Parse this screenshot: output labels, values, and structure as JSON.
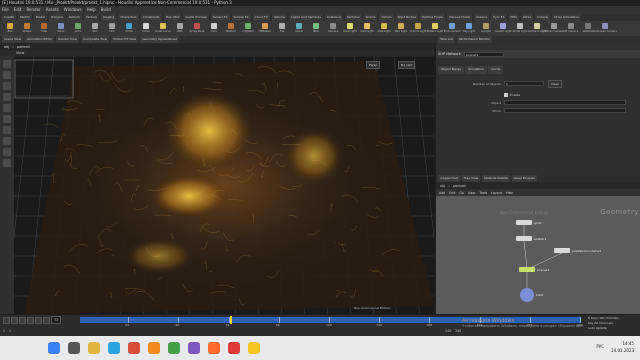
{
  "window": {
    "title": "[E] Houdini 19.0.531 / Mx-_Proekt/Proekt/proekt_1.hipnc - Houdini Apprentice Non-Commercial 19.0.531 - Python 3"
  },
  "menubar": [
    "File",
    "Edit",
    "Render",
    "Assets",
    "Windows",
    "Help",
    "Build"
  ],
  "shelf_tabs": [
    "Create",
    "Modify",
    "Model",
    "Polygon",
    "Deform",
    "Texture",
    "Rigging",
    "Characters",
    "Constraints",
    "Hair Utils",
    "Guide Process",
    "Terrain FX",
    "Simple FX",
    "Cloud FX",
    "Volume",
    "Lights and Cameras",
    "Collisions",
    "Particles",
    "Grains",
    "Vellum",
    "Rigid Bodies",
    "Particle Fluids",
    "Viscous Fluids",
    "Oceans",
    "Pyro FX",
    "FEM",
    "Wires",
    "Crowds",
    "Drive Simulation"
  ],
  "shelf_tools": [
    {
      "label": "Box",
      "color": "#d9a63a"
    },
    {
      "label": "Sphere",
      "color": "#c87a2c"
    },
    {
      "label": "Tube",
      "color": "#b86a2a"
    },
    {
      "label": "Torus",
      "color": "#7a8fc2"
    },
    {
      "label": "Grid",
      "color": "#6aa56a"
    },
    {
      "label": "Null",
      "color": "#aaaaaa"
    },
    {
      "label": "Line",
      "color": "#9f9f9f"
    },
    {
      "label": "Circle",
      "color": "#3ea0d0"
    },
    {
      "label": "Curve",
      "color": "#d8d8d8"
    },
    {
      "label": "Draw Curve",
      "color": "#e0c050"
    },
    {
      "label": "Path",
      "color": "#a8a8a8"
    },
    {
      "label": "Spray Paint",
      "color": "#c05050"
    },
    {
      "label": "Font",
      "color": "#d0d0d0"
    },
    {
      "label": "Platonic",
      "color": "#c07030"
    },
    {
      "label": "L-System",
      "color": "#6ab06a"
    },
    {
      "label": "Metaball",
      "color": "#e09a50"
    },
    {
      "label": "File",
      "color": "#b0b0b0"
    },
    {
      "label": "Spiral",
      "color": "#5ab0c0"
    },
    {
      "label": "Helix",
      "color": "#70c080"
    },
    {
      "label": "Camera",
      "color": "#8a8a8a"
    },
    {
      "label": "Point Light",
      "color": "#e0e070"
    },
    {
      "label": "Spot Light",
      "color": "#e8c060"
    },
    {
      "label": "Area Light",
      "color": "#d8b848"
    },
    {
      "label": "Geo Light",
      "color": "#d0b050"
    },
    {
      "label": "Volume Light",
      "color": "#c8a848"
    },
    {
      "label": "Distant Light",
      "color": "#e0d060"
    },
    {
      "label": "Environment",
      "color": "#70a0d8"
    },
    {
      "label": "Sky Light",
      "color": "#6aa0e0"
    },
    {
      "label": "GI Light",
      "color": "#b0a060"
    },
    {
      "label": "Caustic Light",
      "color": "#a0a0e0"
    },
    {
      "label": "Portal Light",
      "color": "#c0c0c0"
    },
    {
      "label": "Ambient Light",
      "color": "#d0d0a0"
    },
    {
      "label": "Stereo Camera",
      "color": "#9a9a9a"
    },
    {
      "label": "VR Camera",
      "color": "#8a8a8a"
    },
    {
      "label": "Switcher",
      "color": "#7a7a7a"
    },
    {
      "label": "Gamepad Camera",
      "color": "#9090c0"
    }
  ],
  "left_pane_tabs": [
    "Scene View",
    "Animation Editor",
    "Render View",
    "Composite View",
    "Motion FX View",
    "Geometry Spreadsheet"
  ],
  "right_pane_tabs": [
    "Take List",
    "Performance Monitor"
  ],
  "left_path": [
    "obj",
    "portrait"
  ],
  "viewport": {
    "label": "View",
    "persp_button": "Persp",
    "cam_button": "No cam",
    "non_commercial": "Non-Commercial Edition"
  },
  "params": {
    "header_type": "SOP Network",
    "header_name": "popnet1",
    "subtabs": [
      "Object Merge",
      "Simulation",
      "Cache"
    ],
    "rows": [
      {
        "label": "Number of Objects",
        "value": "1",
        "button": "Clear"
      },
      {
        "label": "",
        "value": "Enable",
        "type": "checkbox"
      },
      {
        "label": "Object",
        "value": ""
      },
      {
        "label": "Xform",
        "value": ""
      }
    ]
  },
  "net_tabs": [
    "/obj/portrait",
    "Tree View",
    "Material Palette",
    "Asset Browser"
  ],
  "net_path": [
    "obj",
    "portrait"
  ],
  "net_menu": [
    "Add",
    "Edit",
    "Go",
    "View",
    "Tools",
    "Layout",
    "Help"
  ],
  "net_watermark_small": "Non-Commercial Edition",
  "net_watermark_big": "Geometry",
  "nodes": [
    {
      "name": "grid1",
      "color": "#d9d9d9"
    },
    {
      "name": "scatter1",
      "color": "#d9d9d9"
    },
    {
      "name": "pointsfromvolume1",
      "color": "#d9d9d9"
    },
    {
      "name": "popnet1",
      "color": "#c9e06a"
    },
    {
      "name": "trail1",
      "color": "#7a8fd8"
    }
  ],
  "timeline": {
    "frame": "72",
    "start": "1",
    "end": "240",
    "ticks": [
      "24",
      "48",
      "72",
      "96",
      "120",
      "144",
      "168",
      "192",
      "216",
      "240"
    ],
    "current_fraction": 0.3
  },
  "timeline_bottom": [
    "1",
    "1",
    "240",
    "240"
  ],
  "keys_box": [
    "0 keys, 0/0 channels",
    "Key All Channels",
    "Auto Update"
  ],
  "activate_windows": {
    "title": "Активация Windows",
    "subtitle": "Чтобы активировать Windows, перейдите в раздел «Параметры»."
  },
  "taskbar": {
    "icons": [
      {
        "name": "windows",
        "color": "#3b82f6"
      },
      {
        "name": "search",
        "color": "#555555"
      },
      {
        "name": "explorer",
        "color": "#e0b33e"
      },
      {
        "name": "telegram",
        "color": "#2aa1e0"
      },
      {
        "name": "chrome",
        "color": "#d94c3a"
      },
      {
        "name": "vlc",
        "color": "#f08a1c"
      },
      {
        "name": "app-green",
        "color": "#43a047"
      },
      {
        "name": "app-purple",
        "color": "#7e57c2"
      },
      {
        "name": "houdini",
        "color": "#ff6a2a"
      },
      {
        "name": "yandex",
        "color": "#e03a3a"
      },
      {
        "name": "app-yellow",
        "color": "#f5c518"
      }
    ],
    "lang": "РУС",
    "time": "14:45",
    "date": "24.01.2023"
  }
}
